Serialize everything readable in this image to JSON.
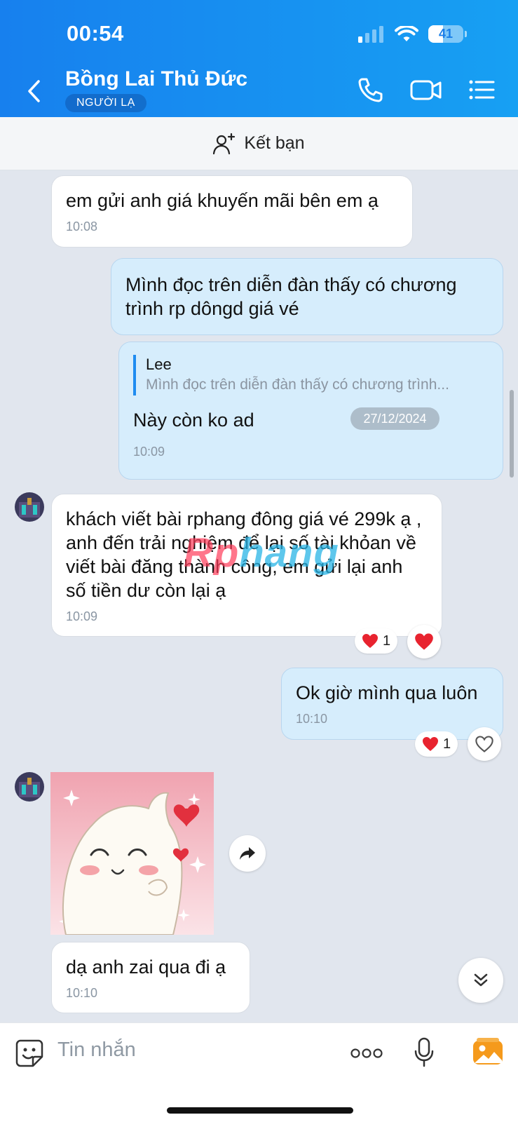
{
  "status_bar": {
    "time": "00:54",
    "battery": "41"
  },
  "header": {
    "title": "Bồng Lai Thủ Đức",
    "badge": "NGƯỜI LẠ",
    "icons": [
      "back-icon",
      "phone-icon",
      "video-call-icon",
      "menu-list-icon"
    ]
  },
  "add_friend": {
    "label": "Kết bạn",
    "icon": "add-user-icon"
  },
  "messages": [
    {
      "direction": "in",
      "text": "em gửi anh giá khuyến mãi bên em ạ",
      "time": "10:08"
    },
    {
      "direction": "out",
      "text": "Mình đọc trên diễn đàn thấy có chương trình rp dôngd giá vé"
    },
    {
      "direction": "out",
      "quote_author": "Lee",
      "quote_text": "Mình đọc trên diễn đàn thấy có chương trình...",
      "text": "Này còn ko ad",
      "time": "10:09"
    },
    {
      "direction": "in",
      "text": "khách viết bài rphang đông giá vé 299k ạ , anh đến trải nghiệm để lại số tài khỏan về viết bài đăng thành công,  em gửi lại anh số tiền dư còn lại ạ",
      "time": "10:09",
      "reaction_count": "1"
    },
    {
      "direction": "out",
      "text": "Ok giờ mình qua luôn",
      "time": "10:10",
      "reaction_count": "1"
    },
    {
      "direction": "in",
      "type": "sticker"
    },
    {
      "direction": "in",
      "text": "dạ anh zai qua đi ạ",
      "time": "10:10"
    }
  ],
  "date_separator": "27/12/2024",
  "watermark": {
    "part1": "Rp",
    "part2": "hang"
  },
  "composer": {
    "placeholder": "Tin nhắn",
    "icons": [
      "sticker-icon",
      "more-icon",
      "microphone-icon",
      "image-icon"
    ]
  },
  "colors": {
    "header": "#1780ee",
    "outgoing": "#d6edfc",
    "incoming": "#ffffff",
    "background": "#e1e6ee"
  }
}
